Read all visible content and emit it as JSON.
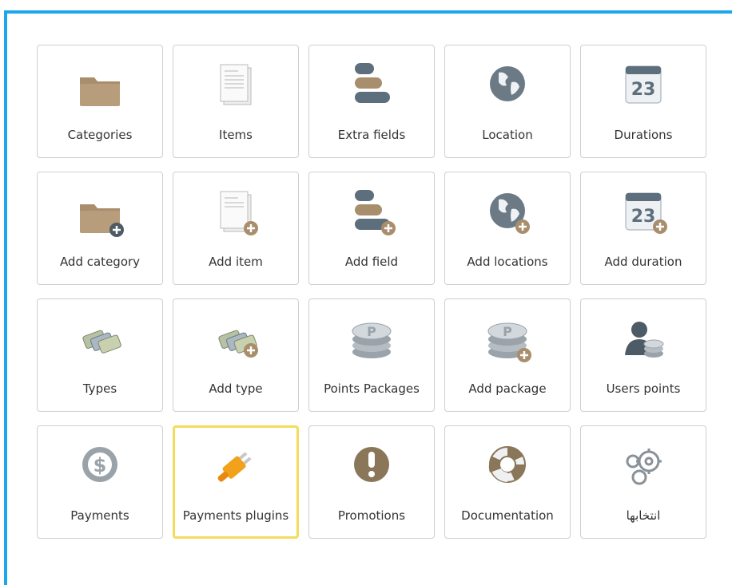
{
  "colors": {
    "frame": "#1ea7e8",
    "selected_border": "#f3dc5c"
  },
  "tiles": [
    {
      "label": "Categories",
      "icon": "folder-icon"
    },
    {
      "label": "Items",
      "icon": "document-icon"
    },
    {
      "label": "Extra fields",
      "icon": "fields-icon"
    },
    {
      "label": "Location",
      "icon": "globe-icon"
    },
    {
      "label": "Durations",
      "icon": "calendar-icon"
    },
    {
      "label": "Add category",
      "icon": "folder-add-icon"
    },
    {
      "label": "Add item",
      "icon": "document-add-icon"
    },
    {
      "label": "Add field",
      "icon": "fields-add-icon"
    },
    {
      "label": "Add locations",
      "icon": "globe-add-icon"
    },
    {
      "label": "Add duration",
      "icon": "calendar-add-icon"
    },
    {
      "label": "Types",
      "icon": "tags-icon"
    },
    {
      "label": "Add type",
      "icon": "tags-add-icon"
    },
    {
      "label": "Points Packages",
      "icon": "coins-icon"
    },
    {
      "label": "Add package",
      "icon": "coins-add-icon"
    },
    {
      "label": "Users points",
      "icon": "user-coins-icon"
    },
    {
      "label": "Payments",
      "icon": "dollar-icon"
    },
    {
      "label": "Payments plugins",
      "icon": "plug-icon"
    },
    {
      "label": "Promotions",
      "icon": "exclamation-icon"
    },
    {
      "label": "Documentation",
      "icon": "lifebuoy-icon"
    },
    {
      "label": "انتخابها",
      "icon": "gears-icon"
    }
  ],
  "calendar_day": "23",
  "coin_letter": "P",
  "dollar_sign": "$"
}
